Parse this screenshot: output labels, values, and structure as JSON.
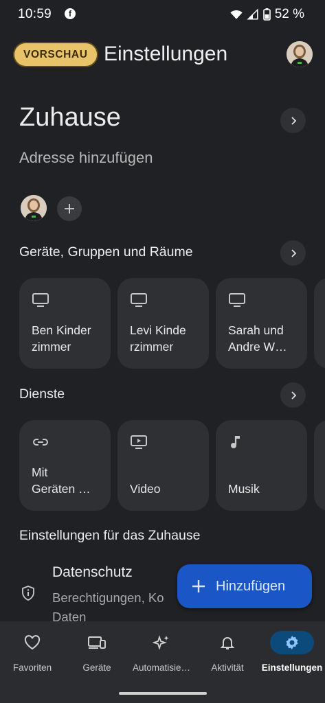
{
  "status_bar": {
    "time": "10:59",
    "app_glyph": "f",
    "battery": "52 %"
  },
  "topbar": {
    "preview_label": "VORSCHAU",
    "title": "Einstellungen"
  },
  "home": {
    "title": "Zuhause",
    "subtitle": "Adresse hinzufügen"
  },
  "sections": {
    "devices": "Geräte, Gruppen und Räume",
    "services": "Dienste",
    "home_settings": "Einstellungen für das Zuhause"
  },
  "rooms": [
    {
      "label": "Ben Kinder\nzimmer",
      "icon": "tv-icon"
    },
    {
      "label": "Levi Kinde\nrzimmer",
      "icon": "tv-icon"
    },
    {
      "label": "Sarah und\nAndre W…",
      "icon": "tv-icon"
    }
  ],
  "services": [
    {
      "label": "Mit\nGeräten …",
      "icon": "link-icon"
    },
    {
      "label": "Video",
      "icon": "video-icon"
    },
    {
      "label": "Musik",
      "icon": "music-note-icon"
    }
  ],
  "privacy": {
    "title": "Datenschutz",
    "subtitle": "Berechtigungen, Ko\nDaten",
    "icon": "shield-info-icon"
  },
  "fab": {
    "label": "Hinzufügen"
  },
  "nav": [
    {
      "label": "Favoriten",
      "icon": "heart-icon",
      "active": false
    },
    {
      "label": "Geräte",
      "icon": "devices-icon",
      "active": false
    },
    {
      "label": "Automatisie…",
      "icon": "sparkle-icon",
      "active": false
    },
    {
      "label": "Aktivität",
      "icon": "bell-icon",
      "active": false
    },
    {
      "label": "Einstellungen",
      "icon": "gear-icon",
      "active": true
    }
  ],
  "colors": {
    "background": "#202124",
    "tile": "#2f3033",
    "fab": "#1a56c6",
    "preview_chip": "#e8c36a",
    "nav_active": "#0b4a7a"
  }
}
